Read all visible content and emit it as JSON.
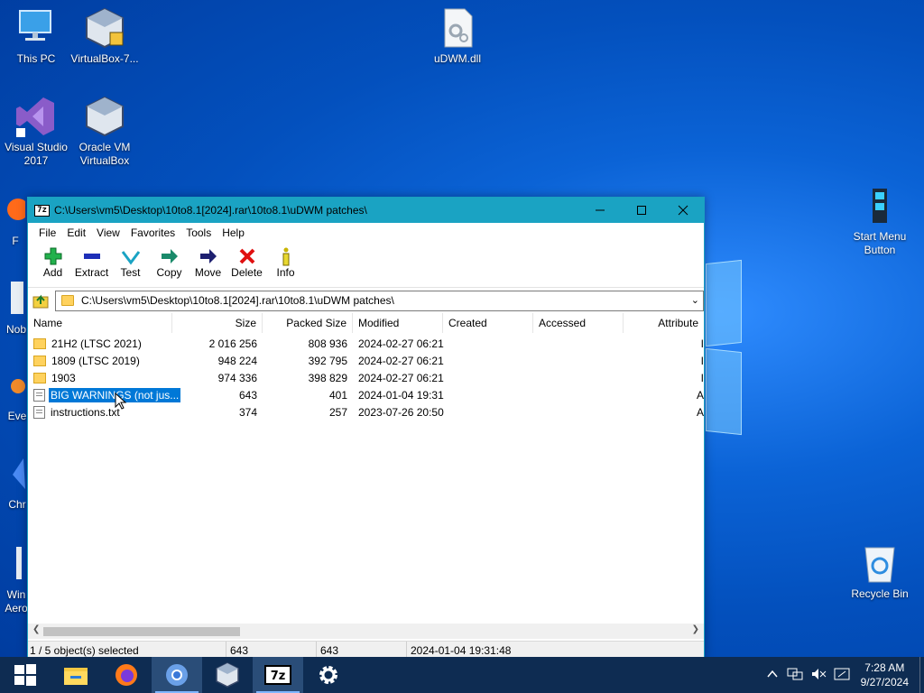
{
  "desktop": {
    "icons": [
      {
        "label": "This PC"
      },
      {
        "label": "VirtualBox-7..."
      },
      {
        "label": "uDWM.dll"
      },
      {
        "label": "Visual Studio 2017"
      },
      {
        "label": "Oracle VM VirtualBox"
      },
      {
        "label": "Start Menu Button"
      },
      {
        "label": "Recycle Bin"
      },
      {
        "label": "F"
      },
      {
        "label": "Nob"
      },
      {
        "label": "Eve"
      },
      {
        "label": "Chr"
      },
      {
        "label": "Win Aero"
      }
    ]
  },
  "window": {
    "icon_text": "7z",
    "title": "C:\\Users\\vm5\\Desktop\\10to8.1[2024].rar\\10to8.1\\uDWM patches\\",
    "menu": [
      "File",
      "Edit",
      "View",
      "Favorites",
      "Tools",
      "Help"
    ],
    "toolbar": [
      {
        "label": "Add",
        "icon": "add-icon"
      },
      {
        "label": "Extract",
        "icon": "extract-icon"
      },
      {
        "label": "Test",
        "icon": "test-icon"
      },
      {
        "label": "Copy",
        "icon": "copy-icon"
      },
      {
        "label": "Move",
        "icon": "move-icon"
      },
      {
        "label": "Delete",
        "icon": "delete-icon"
      },
      {
        "label": "Info",
        "icon": "info-icon"
      }
    ],
    "address": "C:\\Users\\vm5\\Desktop\\10to8.1[2024].rar\\10to8.1\\uDWM patches\\",
    "columns": {
      "name": "Name",
      "size": "Size",
      "packed": "Packed Size",
      "modified": "Modified",
      "created": "Created",
      "accessed": "Accessed",
      "attributes": "Attribute"
    },
    "files": [
      {
        "name": "21H2 (LTSC 2021)",
        "size": "2 016 256",
        "packed": "808 936",
        "modified": "2024-02-27 06:21",
        "attr": "I",
        "type": "folder"
      },
      {
        "name": "1809 (LTSC 2019)",
        "size": "948 224",
        "packed": "392 795",
        "modified": "2024-02-27 06:21",
        "attr": "I",
        "type": "folder"
      },
      {
        "name": "1903",
        "size": "974 336",
        "packed": "398 829",
        "modified": "2024-02-27 06:21",
        "attr": "I",
        "type": "folder"
      },
      {
        "name": "BIG WARNINGS (not jus...",
        "size": "643",
        "packed": "401",
        "modified": "2024-01-04 19:31",
        "attr": "A",
        "type": "txt"
      },
      {
        "name": "instructions.txt",
        "size": "374",
        "packed": "257",
        "modified": "2023-07-26 20:50",
        "attr": "A",
        "type": "txt"
      }
    ],
    "status": {
      "selection": "1 / 5 object(s) selected",
      "size": "643",
      "packed": "643",
      "modified": "2024-01-04 19:31:48"
    }
  },
  "taskbar": {
    "clock_time": "7:28 AM",
    "clock_date": "9/27/2024"
  },
  "colors": {
    "titlebar": "#1aa3c3",
    "selection": "#0078d7",
    "taskbar": "#0e2c52"
  }
}
